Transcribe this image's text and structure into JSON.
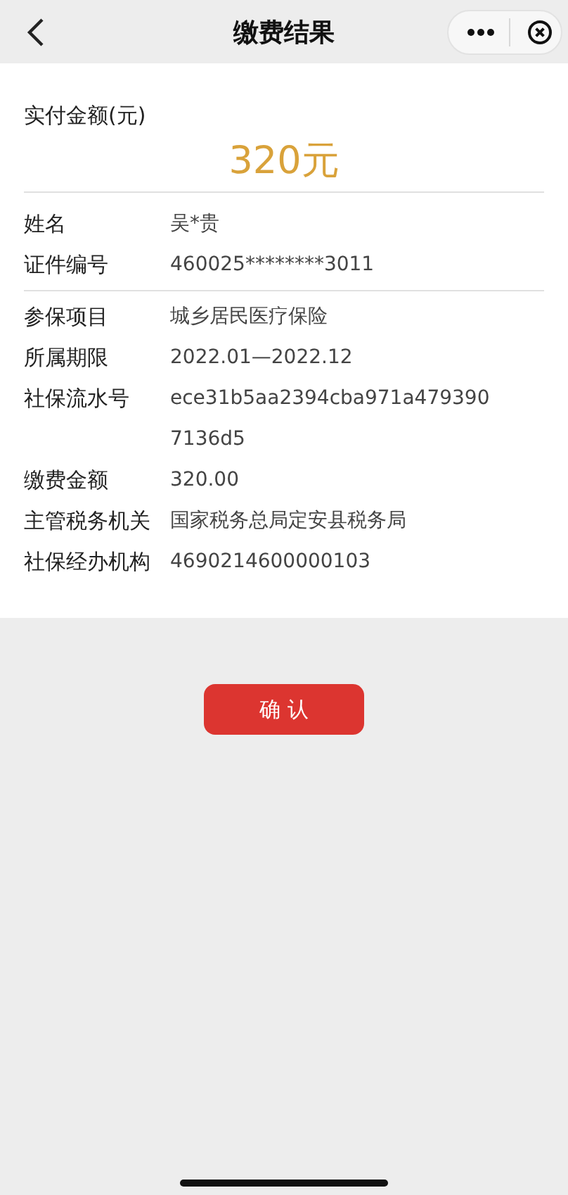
{
  "nav_bar": {
    "title": "缴费结果"
  },
  "summary": {
    "label": "实付金额(元)",
    "amount": "320元"
  },
  "sections": [
    [
      {
        "label": "姓名",
        "value_lines": [
          "吴*贵"
        ]
      },
      {
        "label": "证件编号",
        "value_lines": [
          "460025********3011"
        ]
      }
    ],
    [
      {
        "label": "参保项目",
        "value_lines": [
          "城乡居民医疗保险"
        ]
      },
      {
        "label": "所属期限",
        "value_lines": [
          "2022.01—2022.12"
        ]
      },
      {
        "label": "社保流水号",
        "value_lines": [
          "ece31b5aa2394cba971a479390",
          "7136d5"
        ]
      },
      {
        "label": "缴费金额",
        "value_lines": [
          "320.00"
        ]
      },
      {
        "label": "主管税务机关",
        "value_lines": [
          "国家税务总局定安县税务局"
        ]
      },
      {
        "label": "社保经办机构",
        "value_lines": [
          "4690214600000103"
        ]
      }
    ]
  ],
  "confirm_button": "确 认"
}
